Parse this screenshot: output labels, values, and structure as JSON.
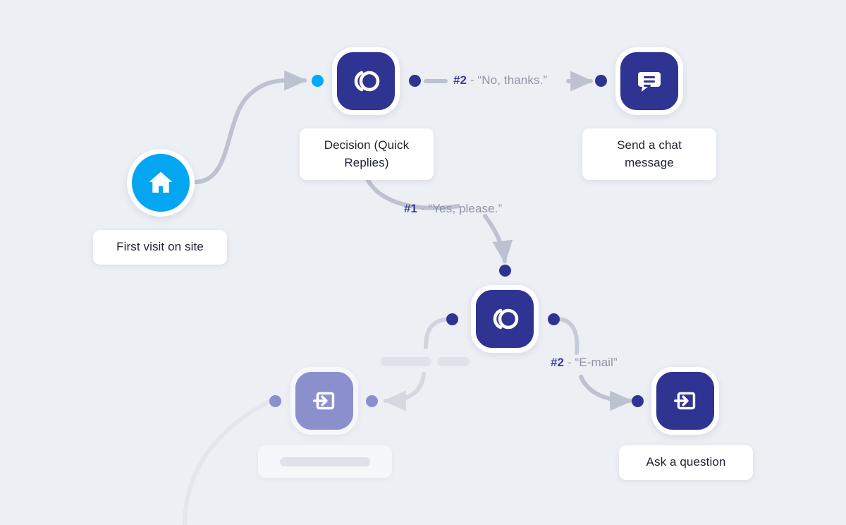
{
  "canvas": {
    "background_color": "#eceff4",
    "accent_primary": "#2f3391",
    "accent_trigger": "#04a6f2",
    "accent_muted": "#8b90cd",
    "wire_color": "#bcc2cf",
    "label_text_color": "#1d2030"
  },
  "nodes": [
    {
      "id": "first-visit",
      "label": "First visit on site",
      "icon": "home-icon",
      "shape": "circle",
      "state": "active"
    },
    {
      "id": "decision-quick-replies",
      "label": "Decision (Quick Replies)",
      "icon": "decision-icon",
      "shape": "rounded-square",
      "state": "active"
    },
    {
      "id": "send-chat-message",
      "label": "Send a chat message",
      "icon": "chat-bubble-icon",
      "shape": "rounded-square",
      "state": "active"
    },
    {
      "id": "decision-second",
      "label": "",
      "icon": "decision-icon",
      "shape": "rounded-square",
      "state": "active"
    },
    {
      "id": "ask-a-question",
      "label": "Ask a question",
      "icon": "ask-question-icon",
      "shape": "rounded-square",
      "state": "active"
    },
    {
      "id": "muted-ask-question",
      "label": "",
      "icon": "ask-question-icon",
      "shape": "rounded-square",
      "state": "muted"
    }
  ],
  "edge_labels": [
    {
      "id": "edge-no-thanks",
      "number": "#2",
      "dash": "-",
      "quote": "“No, thanks.”"
    },
    {
      "id": "edge-yes-please",
      "number": "#1",
      "dash": "-",
      "quote": "“Yes, please.”"
    },
    {
      "id": "edge-email",
      "number": "#2",
      "dash": "-",
      "quote": "“E-mail”"
    }
  ],
  "labels": {
    "first_visit": "First visit on site",
    "decision_quick_replies": "Decision (Quick Replies)",
    "send_chat_message": "Send a chat message",
    "ask_a_question": "Ask a question"
  }
}
